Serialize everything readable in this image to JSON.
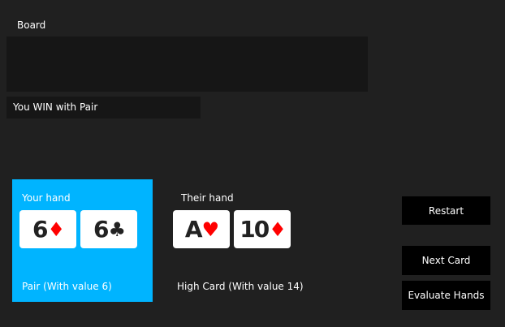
{
  "board": {
    "label": "Board"
  },
  "result": {
    "text": "You WIN with Pair"
  },
  "your_hand": {
    "title": "Your hand",
    "cards": [
      {
        "rank": "6",
        "suit_symbol": "♦",
        "suit_color": "#ff0000"
      },
      {
        "rank": "6",
        "suit_symbol": "♣",
        "suit_color": "#222222"
      }
    ],
    "value_text": "Pair (With value 6)"
  },
  "their_hand": {
    "title": "Their hand",
    "cards": [
      {
        "rank": "A",
        "suit_symbol": "♥",
        "suit_color": "#ff0000"
      },
      {
        "rank": "10",
        "suit_symbol": "♦",
        "suit_color": "#ff0000"
      }
    ],
    "value_text": "High Card (With value 14)"
  },
  "buttons": {
    "restart": "Restart",
    "next_card": "Next Card",
    "evaluate": "Evaluate Hands"
  },
  "colors": {
    "background": "#202020",
    "panel_dark": "#161616",
    "your_hand_accent": "#00b4ff",
    "button": "#000000",
    "card_face": "#ffffff",
    "red_suit": "#ff0000"
  }
}
